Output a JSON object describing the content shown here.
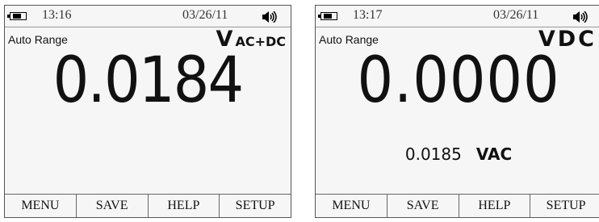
{
  "screens": [
    {
      "status": {
        "time": "13:16",
        "date": "03/26/11",
        "battery_level": 0.8
      },
      "range": "Auto Range",
      "mode": {
        "main": "V",
        "sub": "AC+DC"
      },
      "reading": "0.0184",
      "softkeys": [
        "MENU",
        "SAVE",
        "HELP",
        "SETUP"
      ]
    },
    {
      "status": {
        "time": "13:17",
        "date": "03/26/11",
        "battery_level": 0.8
      },
      "range": "Auto Range",
      "mode": {
        "main": "VDC",
        "sub": ""
      },
      "reading": "0.0000",
      "secondary": {
        "value": "0.0185",
        "unit": "VAC"
      },
      "softkeys": [
        "MENU",
        "SAVE",
        "HELP",
        "SETUP"
      ]
    }
  ],
  "icons": {
    "battery": "battery-icon",
    "speaker": "speaker-icon"
  }
}
